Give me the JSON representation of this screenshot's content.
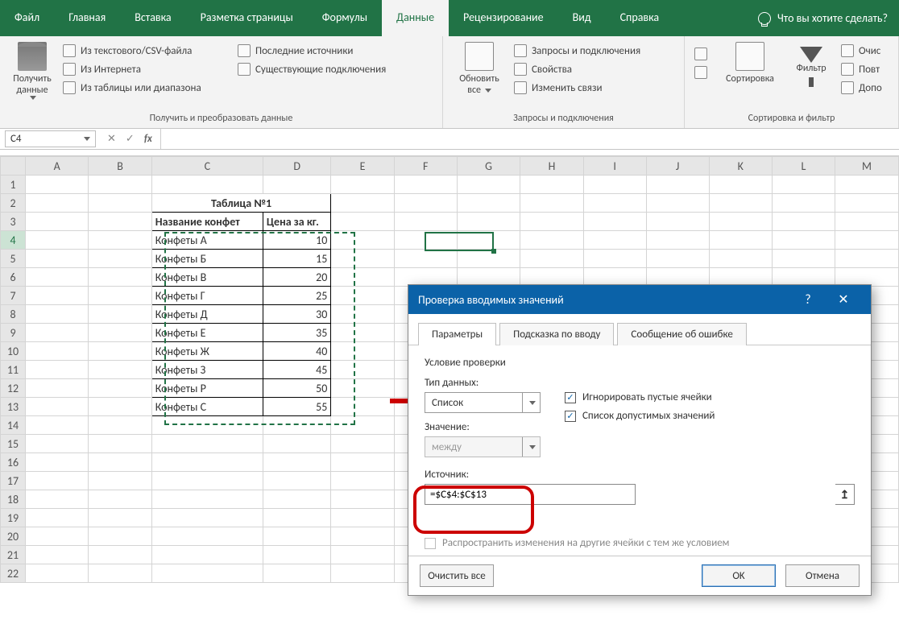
{
  "menubar": {
    "tabs": [
      "Файл",
      "Главная",
      "Вставка",
      "Разметка страницы",
      "Формулы",
      "Данные",
      "Рецензирование",
      "Вид",
      "Справка"
    ],
    "active_index": 5,
    "tell_me": "Что вы хотите сделать?"
  },
  "ribbon": {
    "group1": {
      "label": "Получить и преобразовать данные",
      "get_data": "Получить",
      "get_data2": "данные",
      "from_csv": "Из текстового/CSV-файла",
      "from_web": "Из Интернета",
      "from_table": "Из таблицы или диапазона",
      "recent": "Последние источники",
      "existing": "Существующие подключения"
    },
    "group2": {
      "label": "Запросы и подключения",
      "refresh": "Обновить",
      "refresh2": "все",
      "queries": "Запросы и подключения",
      "properties": "Свойства",
      "edit_links": "Изменить связи"
    },
    "group3": {
      "label": "Сортировка и фильтр",
      "sort": "Сортировка",
      "filter": "Фильтр",
      "clear": "Очис",
      "reapply": "Повт",
      "advanced": "Допо"
    }
  },
  "namebox": {
    "value": "C4",
    "fx": "fx"
  },
  "columns": [
    "A",
    "B",
    "C",
    "D",
    "E",
    "F",
    "G",
    "H",
    "I",
    "J",
    "K",
    "L",
    "M"
  ],
  "sheet": {
    "title": "Таблица №1",
    "header1": "Название конфет",
    "header2": "Цена за кг.",
    "rows": [
      {
        "name": "Конфеты А",
        "price": "10"
      },
      {
        "name": "Конфеты Б",
        "price": "15"
      },
      {
        "name": "Конфеты В",
        "price": "20"
      },
      {
        "name": "Конфеты Г",
        "price": "25"
      },
      {
        "name": "Конфеты Д",
        "price": "30"
      },
      {
        "name": "Конфеты Е",
        "price": "35"
      },
      {
        "name": "Конфеты Ж",
        "price": "40"
      },
      {
        "name": "Конфеты З",
        "price": "45"
      },
      {
        "name": "Конфеты Р",
        "price": "50"
      },
      {
        "name": "Конфеты С",
        "price": "55"
      }
    ]
  },
  "dialog": {
    "title": "Проверка вводимых значений",
    "help": "?",
    "close": "✕",
    "tabs": [
      "Параметры",
      "Подсказка по вводу",
      "Сообщение об ошибке"
    ],
    "active_tab": 0,
    "cond_label": "Условие проверки",
    "type_label": "Тип данных:",
    "type_value": "Список",
    "ignore_blank": "Игнорировать пустые ячейки",
    "in_cell_dropdown": "Список допустимых значений",
    "value_label": "Значение:",
    "value_value": "между",
    "source_label": "Источник:",
    "source_value": "=$C$4:$C$13",
    "propagate": "Распространить изменения на другие ячейки с тем же условием",
    "clear_all": "Очистить все",
    "ok": "OK",
    "cancel": "Отмена"
  }
}
